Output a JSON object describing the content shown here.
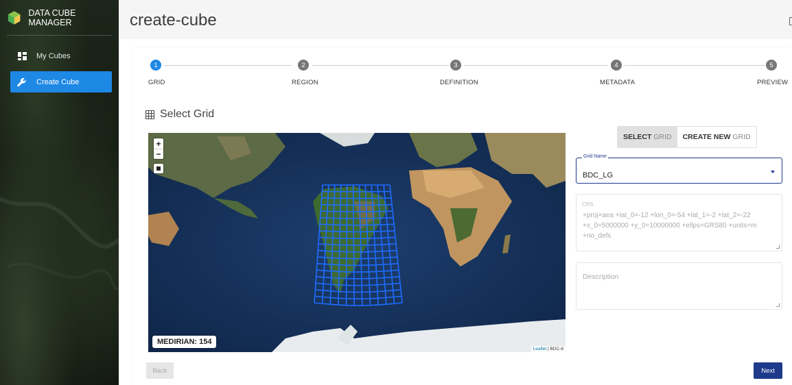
{
  "app": {
    "title": "DATA CUBE MANAGER"
  },
  "sidebar": {
    "items": [
      {
        "label": "My Cubes",
        "icon": "dashboard-icon",
        "active": false
      },
      {
        "label": "Create Cube",
        "icon": "wrench-icon",
        "active": true
      }
    ]
  },
  "header": {
    "title": "create-cube"
  },
  "stepper": {
    "steps": [
      {
        "number": "1",
        "label": "GRID",
        "active": true
      },
      {
        "number": "2",
        "label": "REGION",
        "active": false
      },
      {
        "number": "3",
        "label": "DEFINITION",
        "active": false
      },
      {
        "number": "4",
        "label": "METADATA",
        "active": false
      },
      {
        "number": "5",
        "label": "PREVIEW",
        "active": false
      }
    ]
  },
  "section": {
    "title": "Select Grid",
    "icon": "grid-table-icon"
  },
  "map": {
    "zoom_in": "+",
    "zoom_out": "−",
    "meridian_label": "MEDIRIAN: 154",
    "attribution_leaflet": "Leaflet",
    "attribution_sep": " | ",
    "attribution_source": "BDC-6"
  },
  "grid_toggle": {
    "select_bold": "SELECT",
    "select_light": "GRID",
    "create_bold": "CREATE NEW",
    "create_light": "GRID"
  },
  "form": {
    "grid_name_label": "Grid Name",
    "grid_name_value": "BDC_LG",
    "crs_label": "CRS",
    "crs_value": "+proj=aea +lat_0=-12 +lon_0=-54 +lat_1=-2 +lat_2=-22 +x_0=5000000 +y_0=10000000 +ellps=GRS80 +units=m +no_defs",
    "description_placeholder": "Description"
  },
  "actions": {
    "back_label": "Back",
    "next_label": "Next"
  },
  "colors": {
    "primary": "#1e88e5",
    "dark_blue": "#1e3a8a",
    "grid_blue": "#1e6cff"
  }
}
